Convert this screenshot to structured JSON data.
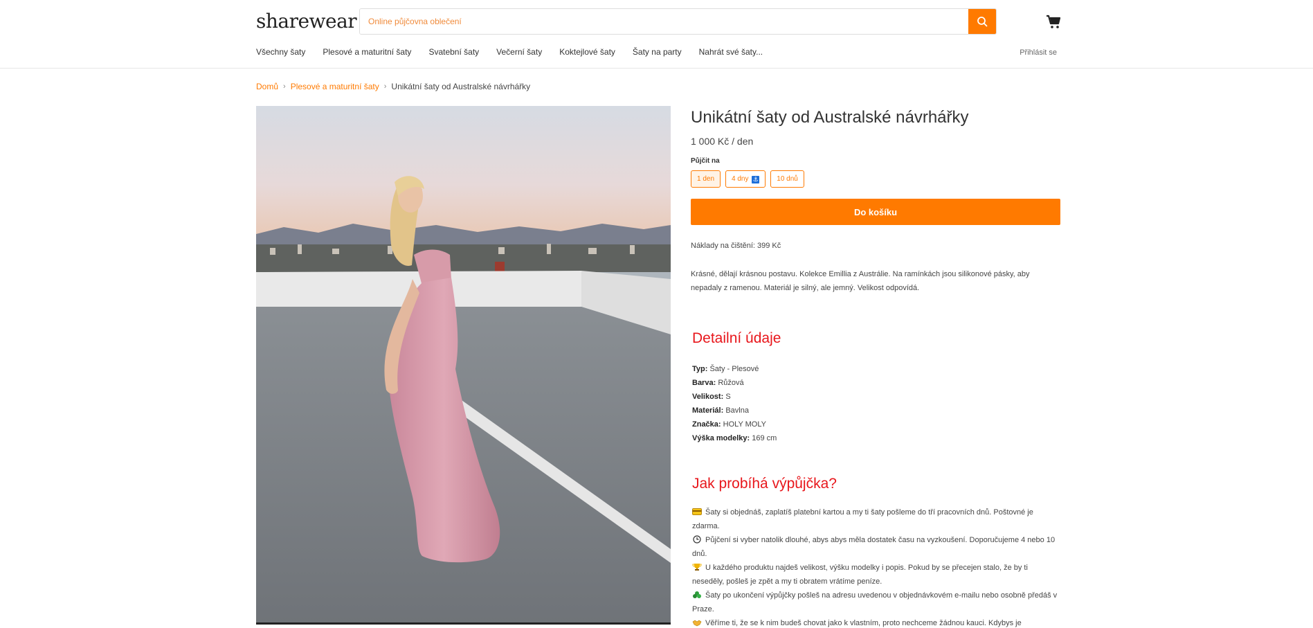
{
  "header": {
    "logo": "sharewear",
    "search_placeholder": "Online půjčovna oblečení",
    "login": "Přihlásit se"
  },
  "nav": [
    "Všechny šaty",
    "Plesové a maturitní šaty",
    "Svatební šaty",
    "Večerní šaty",
    "Koktejlové šaty",
    "Šaty na party",
    "Nahrát své šaty..."
  ],
  "breadcrumb": {
    "home": "Domů",
    "category": "Plesové a maturitní šaty",
    "current": "Unikátní šaty od Australské návrhářky"
  },
  "product": {
    "title": "Unikátní šaty od Australské návrhářky",
    "price": "1 000 Kč / den",
    "rent_label": "Půjčit na",
    "rent_options": [
      "1 den",
      "4 dny",
      "10 dnů"
    ],
    "add_to_cart": "Do košíku",
    "cleaning": "Náklady na čištění: 399 Kč",
    "description": "Krásné, dělají krásnou postavu. Kolekce Emillia z Austrálie. Na ramínkách jsou silikonové pásky, aby nepadaly z ramenou. Materiál je silný, ale jemný. Velikost odpovídá."
  },
  "details": {
    "heading": "Detailní údaje",
    "items": [
      {
        "label": "Typ:",
        "value": " Šaty - Plesové"
      },
      {
        "label": "Barva:",
        "value": "Růžová"
      },
      {
        "label": "Velikost:",
        "value": "S"
      },
      {
        "label": "Materiál:",
        "value": "Bavlna"
      },
      {
        "label": "Značka:",
        "value": "HOLY MOLY"
      },
      {
        "label": "Výška modelky:",
        "value": "169 cm"
      }
    ]
  },
  "how": {
    "heading": "Jak probíhá výpůjčka?",
    "items": [
      {
        "icon": "credit-card-icon",
        "text": "Šaty si objednáš, zaplatíš platební kartou a my ti šaty pošleme do tří pracovních dnů. Poštovné je zdarma."
      },
      {
        "icon": "clock-icon",
        "text": "Půjčení si vyber natolik dlouhé, abys abys měla dostatek času na vyzkoušení. Doporučujeme 4 nebo 10 dnů."
      },
      {
        "icon": "trophy-icon",
        "text": "U každého produktu najdeš velikost, výšku modelky i popis. Pokud by se přecejen stalo, že by ti neseděly, pošleš je zpět a my ti obratem vrátíme peníze."
      },
      {
        "icon": "recycle-icon",
        "text": "Šaty po ukončení výpůjčky pošleš na adresu uvedenou v objednávkovém e-mailu nebo osobně předáš v Praze."
      },
      {
        "icon": "handshake-icon",
        "text": "Věříme ti, že se k nim budeš chovat jako k vlastním, proto nechceme žádnou kauci. Kdybys je"
      }
    ]
  },
  "colors": {
    "accent": "#ff7a00",
    "section_heading": "#e8161b"
  }
}
